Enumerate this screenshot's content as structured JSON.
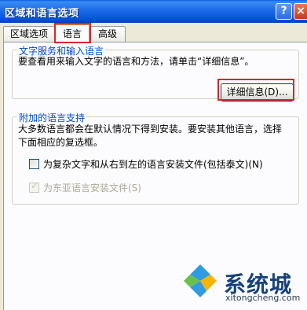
{
  "window": {
    "title": "区域和语言选项",
    "help_label": "?",
    "close_label": "×"
  },
  "tabs": [
    {
      "label": "区域选项"
    },
    {
      "label": "语言"
    },
    {
      "label": "高级"
    }
  ],
  "text_services": {
    "legend": "文字服务和输入语言",
    "description": "要查看用来输入文字的语言和方法，请单击“详细信息”。",
    "details_button": "详细信息(D)..."
  },
  "supplemental": {
    "legend": "附加的语言支持",
    "description_line1": "大多数语言都会在默认情况下得到安装。要安装其他语言，选择",
    "description_line2": "下面相应的复选框。",
    "complex_script": {
      "label": "为复杂文字和从右到左的语言安装文件(包括泰文)(N)",
      "checked": false,
      "enabled": true
    },
    "east_asian": {
      "label": "为东亚语言安装文件(S)",
      "checked": true,
      "enabled": false
    }
  },
  "watermark": {
    "brand": "系统城",
    "url": "xitongcheng.com"
  },
  "colors": {
    "title_bar": "#0055e5",
    "legend": "#0046d5",
    "highlight": "#d8262a"
  }
}
